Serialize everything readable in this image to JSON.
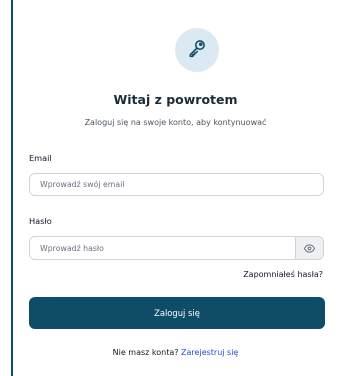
{
  "header": {
    "icon": "key-icon",
    "title": "Witaj z powrotem",
    "subtitle": "Zaloguj się na swoje konto, aby kontynuować"
  },
  "form": {
    "email_label": "Email",
    "email_placeholder": "Wprowadź swój email",
    "email_value": "",
    "password_label": "Hasło",
    "password_placeholder": "Wprowadź hasło",
    "password_value": "",
    "password_toggle_icon": "eye-icon",
    "forgot_label": "Zapomniałeś hasła?",
    "submit_label": "Zaloguj się"
  },
  "footer": {
    "prompt": "Nie masz konta?",
    "signup_label": "Zarejestruj się"
  },
  "colors": {
    "primary": "#0f4c68",
    "icon_bg": "#dbe9f2",
    "link": "#1d4ed8"
  }
}
